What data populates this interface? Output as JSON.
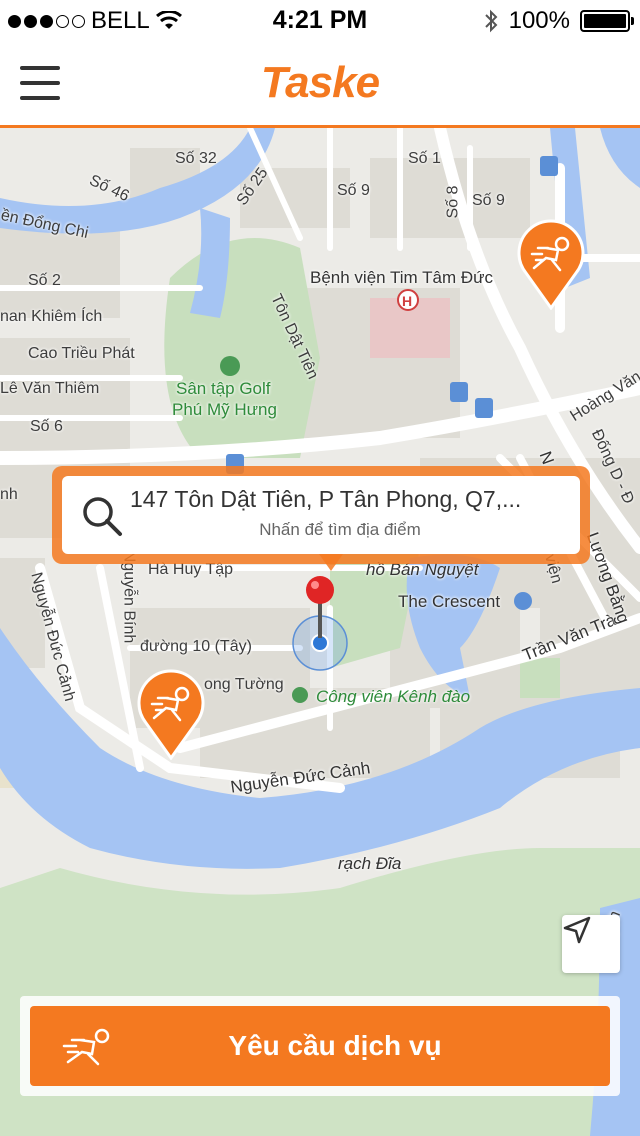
{
  "status_bar": {
    "carrier": "BELL",
    "time": "4:21 PM",
    "battery": "100%"
  },
  "nav": {
    "brand": "Taske",
    "menu_icon": "hamburger-menu-icon"
  },
  "search": {
    "address": "147 Tôn Dật Tiên, P Tân Phong, Q7,...",
    "hint": "Nhấn để tìm địa điểm",
    "icon": "search-icon"
  },
  "map": {
    "labels": {
      "so32": "Số 32",
      "so1": "Số 1",
      "so46": "Số 46",
      "so25": "Số 25",
      "so9a": "Số 9",
      "so8": "Số 8",
      "so9b": "Số 9",
      "dongchi": "ền Đổng Chi",
      "so2": "Số 2",
      "benhvien": "Bệnh viện Tim Tâm Đức",
      "khiemich": "nan Khiêm Ích",
      "tondattien": "Tôn Dật Tiên",
      "caotrieuphat": "Cao Triều Phát",
      "santap": "Sân tập Golf",
      "phumyhung": "Phú Mỹ Hưng",
      "vanthiem": "Lê Văn Thiêm",
      "so6": "Số 6",
      "hoangvan": "Hoàng Văn",
      "nh": "nh",
      "haduytap": "Hà Huy Tập",
      "hobannguyet": "hồ Bán Nguyệt",
      "vien": "viện",
      "thecrescent": "The Crescent",
      "nguyenducanh1": "Nguyễn Đức Cảnh",
      "nguyenbinh": "Nguyễn Bính",
      "duong10": "đường 10 (Tây)",
      "tranvantra": "Trần Văn Trà",
      "longtuong": "ong Tường",
      "congvien": "Công viên Kênh đào",
      "nguyenducanh2": "Nguyễn Đức Cảnh",
      "rachdia": "rạch Đĩa",
      "luongbang": "Lương Bằng",
      "dong": "Đống D - Đ",
      "nguyen": "N",
      "rach": "rạch"
    },
    "pin_icon": "delivery-runner-icon",
    "locate_icon": "navigation-arrow-icon"
  },
  "cta": {
    "label": "Yêu cầu dịch vụ",
    "icon": "delivery-runner-icon"
  },
  "colors": {
    "accent": "#f47920",
    "water": "#a5c4f3",
    "park": "#c8dfbe",
    "road": "#ffffff"
  }
}
